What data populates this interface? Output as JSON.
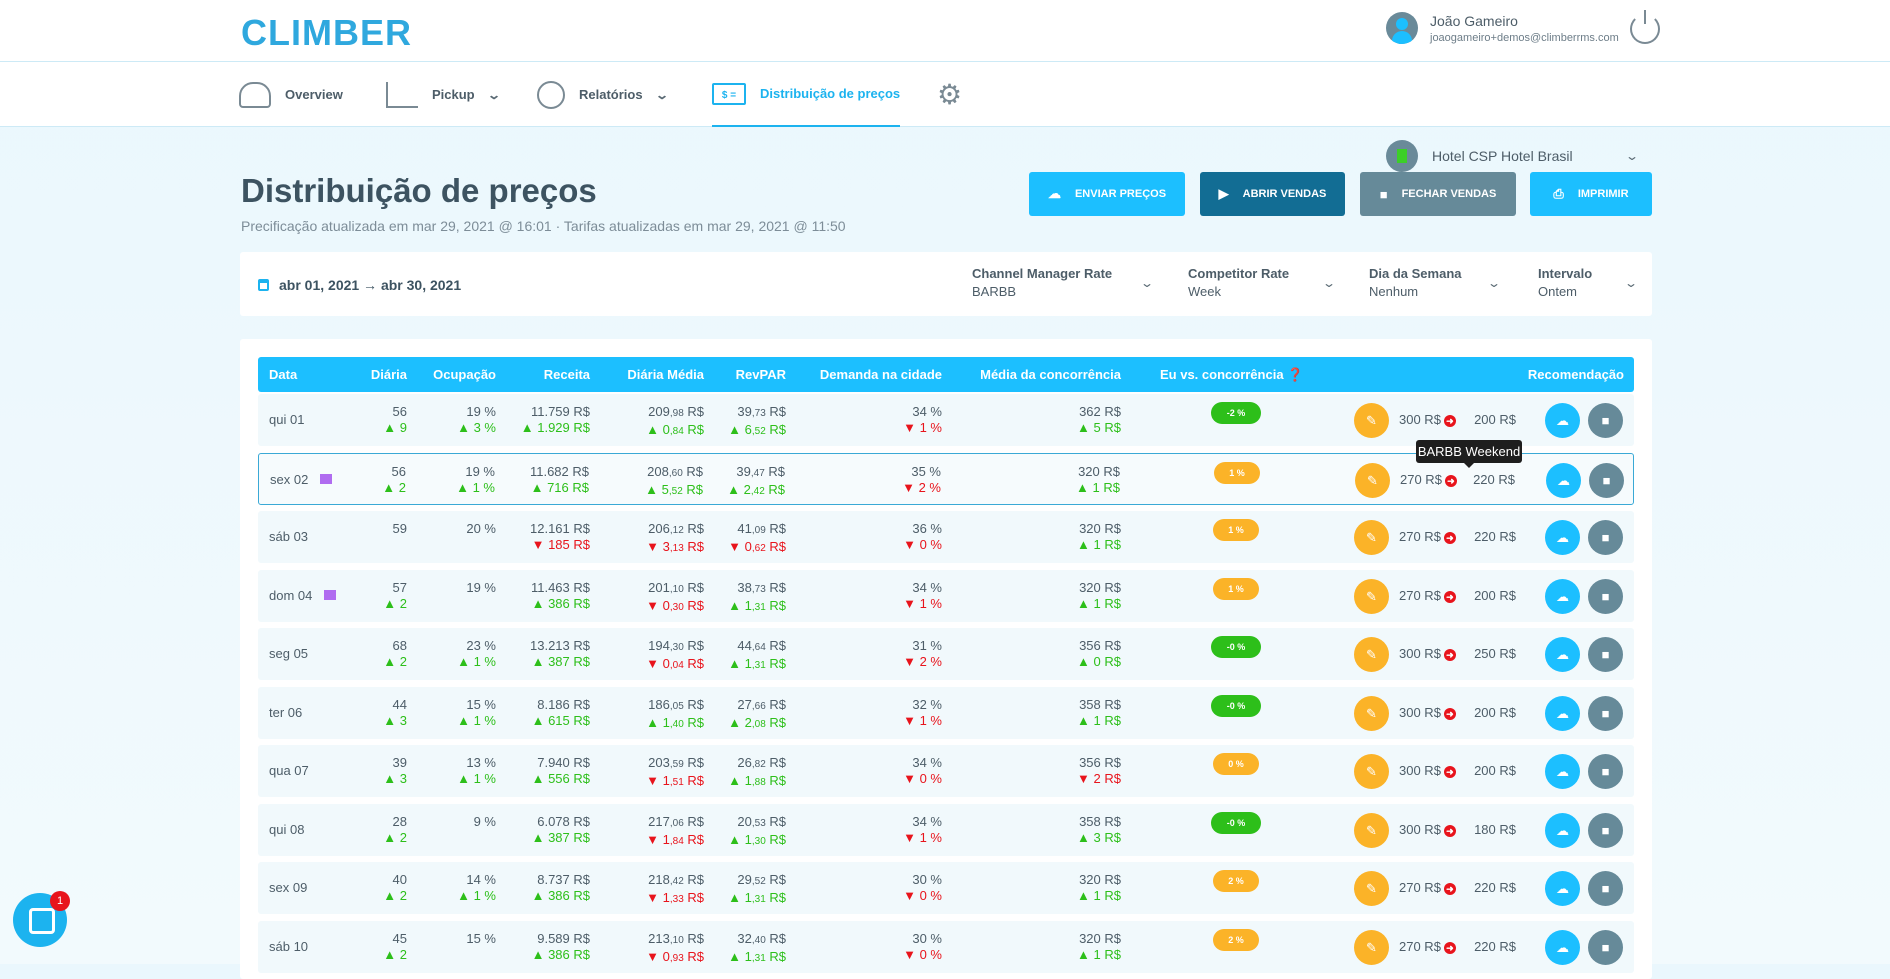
{
  "app": {
    "logo": "CLIMBER"
  },
  "user": {
    "name": "João Gameiro",
    "email": "joaogameiro+demos@climberrms.com"
  },
  "nav": {
    "overview": "Overview",
    "pickup": "Pickup",
    "reports": "Relatórios",
    "pricing": "Distribuição de preços",
    "pricing_icon_text": "$ ="
  },
  "hotel": {
    "name": "Hotel CSP Hotel Brasil"
  },
  "page": {
    "title": "Distribuição de preços",
    "subtitle": "Precificação atualizada em mar 29, 2021 @ 16:01 · Tarifas atualizadas em mar 29, 2021 @ 11:50"
  },
  "actions": {
    "send": "ENVIAR PREÇOS",
    "open": "ABRIR VENDAS",
    "close": "FECHAR VENDAS",
    "print": "IMPRIMIR"
  },
  "filters": {
    "date_range": "abr 01, 2021 → abr 30, 2021",
    "channel_label": "Channel Manager Rate",
    "channel_value": "BARBB",
    "competitor_label": "Competitor Rate",
    "competitor_value": "Week",
    "weekday_label": "Dia da Semana",
    "weekday_value": "Nenhum",
    "interval_label": "Intervalo",
    "interval_value": "Ontem"
  },
  "table": {
    "headers": {
      "date": "Data",
      "rooms": "Diária",
      "occupancy": "Ocupação",
      "revenue": "Receita",
      "adr": "Diária Média",
      "revpar": "RevPAR",
      "demand": "Demanda na cidade",
      "comp_avg": "Média da concorrência",
      "me_vs": "Eu vs. concorrência",
      "recommendation": "Recomendação"
    },
    "tooltip": "BARBB Weekend",
    "colors": {
      "green": "#2dbf1a",
      "red": "#e8141c",
      "orange": "#fbb328",
      "header": "#1cbfff"
    },
    "rows": [
      {
        "date": "qui 01",
        "flag": false,
        "rooms": "56",
        "rooms_d": {
          "dir": "up",
          "v": "9"
        },
        "occ": "19 %",
        "occ_d": {
          "dir": "up",
          "v": "3 %"
        },
        "rev": "11.759 R$",
        "rev_d": {
          "dir": "up",
          "v": "1.929 R$"
        },
        "adr": "209,98 R$",
        "adr_d": {
          "dir": "up",
          "v": "0,84 R$"
        },
        "revpar": "39,73 R$",
        "revpar_d": {
          "dir": "up",
          "v": "6,52 R$"
        },
        "dem": "34 %",
        "dem_d": {
          "dir": "dn",
          "v": "1 %"
        },
        "comp": "362 R$",
        "comp_d": {
          "dir": "up",
          "v": "5 R$"
        },
        "vs": "-2 %",
        "vs_color": "green",
        "price": "300 R$",
        "rec": "200 R$"
      },
      {
        "date": "sex 02",
        "flag": true,
        "rooms": "56",
        "rooms_d": {
          "dir": "up",
          "v": "2"
        },
        "occ": "19 %",
        "occ_d": {
          "dir": "up",
          "v": "1 %"
        },
        "rev": "11.682 R$",
        "rev_d": {
          "dir": "up",
          "v": "716 R$"
        },
        "adr": "208,60 R$",
        "adr_d": {
          "dir": "up",
          "v": "5,52 R$"
        },
        "revpar": "39,47 R$",
        "revpar_d": {
          "dir": "up",
          "v": "2,42 R$"
        },
        "dem": "35 %",
        "dem_d": {
          "dir": "dn",
          "v": "2 %"
        },
        "comp": "320 R$",
        "comp_d": {
          "dir": "up",
          "v": "1 R$"
        },
        "vs": "1 %",
        "vs_color": "orange",
        "price": "270 R$",
        "rec": "220 R$",
        "selected": true
      },
      {
        "date": "sáb 03",
        "flag": false,
        "rooms": "59",
        "rooms_d": null,
        "occ": "20 %",
        "occ_d": null,
        "rev": "12.161 R$",
        "rev_d": {
          "dir": "dn",
          "v": "185 R$"
        },
        "adr": "206,12 R$",
        "adr_d": {
          "dir": "dn",
          "v": "3,13 R$"
        },
        "revpar": "41,09 R$",
        "revpar_d": {
          "dir": "dn",
          "v": "0,62 R$"
        },
        "dem": "36 %",
        "dem_d": {
          "dir": "dn",
          "v": "0 %"
        },
        "comp": "320 R$",
        "comp_d": {
          "dir": "up",
          "v": "1 R$"
        },
        "vs": "1 %",
        "vs_color": "orange",
        "price": "270 R$",
        "rec": "220 R$"
      },
      {
        "date": "dom 04",
        "flag": true,
        "rooms": "57",
        "rooms_d": {
          "dir": "up",
          "v": "2"
        },
        "occ": "19 %",
        "occ_d": null,
        "rev": "11.463 R$",
        "rev_d": {
          "dir": "up",
          "v": "386 R$"
        },
        "adr": "201,10 R$",
        "adr_d": {
          "dir": "dn",
          "v": "0,30 R$"
        },
        "revpar": "38,73 R$",
        "revpar_d": {
          "dir": "up",
          "v": "1,31 R$"
        },
        "dem": "34 %",
        "dem_d": {
          "dir": "dn",
          "v": "1 %"
        },
        "comp": "320 R$",
        "comp_d": {
          "dir": "up",
          "v": "1 R$"
        },
        "vs": "1 %",
        "vs_color": "orange",
        "price": "270 R$",
        "rec": "200 R$"
      },
      {
        "date": "seg 05",
        "flag": false,
        "rooms": "68",
        "rooms_d": {
          "dir": "up",
          "v": "2"
        },
        "occ": "23 %",
        "occ_d": {
          "dir": "up",
          "v": "1 %"
        },
        "rev": "13.213 R$",
        "rev_d": {
          "dir": "up",
          "v": "387 R$"
        },
        "adr": "194,30 R$",
        "adr_d": {
          "dir": "dn",
          "v": "0,04 R$"
        },
        "revpar": "44,64 R$",
        "revpar_d": {
          "dir": "up",
          "v": "1,31 R$"
        },
        "dem": "31 %",
        "dem_d": {
          "dir": "dn",
          "v": "2 %"
        },
        "comp": "356 R$",
        "comp_d": {
          "dir": "up",
          "v": "0 R$"
        },
        "vs": "-0 %",
        "vs_color": "green",
        "price": "300 R$",
        "rec": "250 R$"
      },
      {
        "date": "ter 06",
        "flag": false,
        "rooms": "44",
        "rooms_d": {
          "dir": "up",
          "v": "3"
        },
        "occ": "15 %",
        "occ_d": {
          "dir": "up",
          "v": "1 %"
        },
        "rev": "8.186 R$",
        "rev_d": {
          "dir": "up",
          "v": "615 R$"
        },
        "adr": "186,05 R$",
        "adr_d": {
          "dir": "up",
          "v": "1,40 R$"
        },
        "revpar": "27,66 R$",
        "revpar_d": {
          "dir": "up",
          "v": "2,08 R$"
        },
        "dem": "32 %",
        "dem_d": {
          "dir": "dn",
          "v": "1 %"
        },
        "comp": "358 R$",
        "comp_d": {
          "dir": "up",
          "v": "1 R$"
        },
        "vs": "-0 %",
        "vs_color": "green",
        "price": "300 R$",
        "rec": "200 R$"
      },
      {
        "date": "qua 07",
        "flag": false,
        "rooms": "39",
        "rooms_d": {
          "dir": "up",
          "v": "3"
        },
        "occ": "13 %",
        "occ_d": {
          "dir": "up",
          "v": "1 %"
        },
        "rev": "7.940 R$",
        "rev_d": {
          "dir": "up",
          "v": "556 R$"
        },
        "adr": "203,59 R$",
        "adr_d": {
          "dir": "dn",
          "v": "1,51 R$"
        },
        "revpar": "26,82 R$",
        "revpar_d": {
          "dir": "up",
          "v": "1,88 R$"
        },
        "dem": "34 %",
        "dem_d": {
          "dir": "dn",
          "v": "0 %"
        },
        "comp": "356 R$",
        "comp_d": {
          "dir": "dn",
          "v": "2 R$"
        },
        "vs": "0 %",
        "vs_color": "orange",
        "price": "300 R$",
        "rec": "200 R$"
      },
      {
        "date": "qui 08",
        "flag": false,
        "rooms": "28",
        "rooms_d": {
          "dir": "up",
          "v": "2"
        },
        "occ": "9 %",
        "occ_d": null,
        "rev": "6.078 R$",
        "rev_d": {
          "dir": "up",
          "v": "387 R$"
        },
        "adr": "217,06 R$",
        "adr_d": {
          "dir": "dn",
          "v": "1,84 R$"
        },
        "revpar": "20,53 R$",
        "revpar_d": {
          "dir": "up",
          "v": "1,30 R$"
        },
        "dem": "34 %",
        "dem_d": {
          "dir": "dn",
          "v": "1 %"
        },
        "comp": "358 R$",
        "comp_d": {
          "dir": "up",
          "v": "3 R$"
        },
        "vs": "-0 %",
        "vs_color": "green",
        "price": "300 R$",
        "rec": "180 R$"
      },
      {
        "date": "sex 09",
        "flag": false,
        "rooms": "40",
        "rooms_d": {
          "dir": "up",
          "v": "2"
        },
        "occ": "14 %",
        "occ_d": {
          "dir": "up",
          "v": "1 %"
        },
        "rev": "8.737 R$",
        "rev_d": {
          "dir": "up",
          "v": "386 R$"
        },
        "adr": "218,42 R$",
        "adr_d": {
          "dir": "dn",
          "v": "1,33 R$"
        },
        "revpar": "29,52 R$",
        "revpar_d": {
          "dir": "up",
          "v": "1,31 R$"
        },
        "dem": "30 %",
        "dem_d": {
          "dir": "dn",
          "v": "0 %"
        },
        "comp": "320 R$",
        "comp_d": {
          "dir": "up",
          "v": "1 R$"
        },
        "vs": "2 %",
        "vs_color": "orange",
        "price": "270 R$",
        "rec": "220 R$"
      },
      {
        "date": "sáb 10",
        "flag": false,
        "rooms": "45",
        "rooms_d": {
          "dir": "up",
          "v": "2"
        },
        "occ": "15 %",
        "occ_d": null,
        "rev": "9.589 R$",
        "rev_d": {
          "dir": "up",
          "v": "386 R$"
        },
        "adr": "213,10 R$",
        "adr_d": {
          "dir": "dn",
          "v": "0,93 R$"
        },
        "revpar": "32,40 R$",
        "revpar_d": {
          "dir": "up",
          "v": "1,31 R$"
        },
        "dem": "30 %",
        "dem_d": {
          "dir": "dn",
          "v": "0 %"
        },
        "comp": "320 R$",
        "comp_d": {
          "dir": "up",
          "v": "1 R$"
        },
        "vs": "2 %",
        "vs_color": "orange",
        "price": "270 R$",
        "rec": "220 R$"
      }
    ]
  },
  "chat": {
    "badge": "1"
  }
}
